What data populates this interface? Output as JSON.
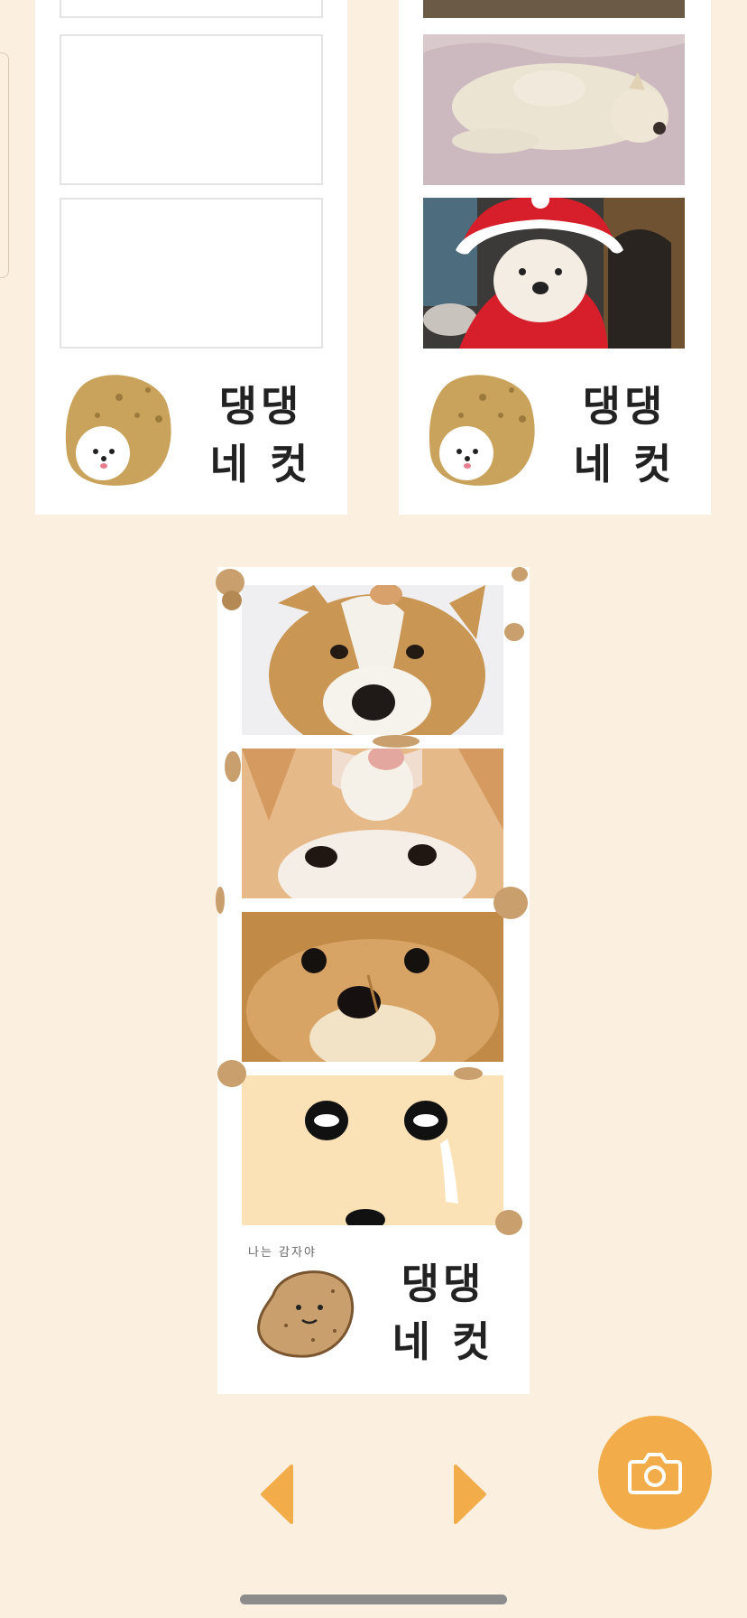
{
  "theme": {
    "background": "#fbf0df",
    "accent": "#f2ac4a",
    "potato": "#c9a35b"
  },
  "frames": {
    "left": {
      "brand_line1": "댕댕",
      "brand_line2": "네 컷",
      "slots": [
        "empty",
        "empty"
      ]
    },
    "right": {
      "brand_line1": "댕댕",
      "brand_line2": "네 컷",
      "slots": [
        "white dog lying on blanket",
        "white dog in santa costume"
      ]
    },
    "selected": {
      "brand_line1": "댕댕",
      "brand_line2": "네 컷",
      "caption": "나는 감자야",
      "slots": [
        "corgi face close-up",
        "corgi face eyes",
        "pomeranian face",
        "crying cartoon face"
      ]
    }
  },
  "controls": {
    "prev_icon": "chevron-left-icon",
    "next_icon": "chevron-right-icon",
    "camera_icon": "camera-icon"
  }
}
